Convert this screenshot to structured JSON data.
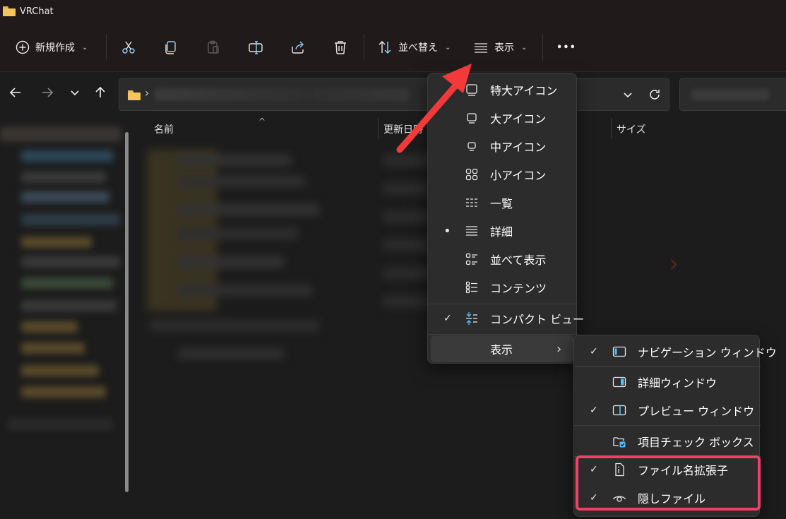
{
  "window": {
    "title": "VRChat"
  },
  "toolbar": {
    "new_label": "新規作成",
    "sort_label": "並べ替え",
    "view_label": "表示",
    "more_label": "•••"
  },
  "file_list": {
    "columns": [
      "名前",
      "更新日時",
      "サイズ"
    ]
  },
  "view_menu": {
    "items": [
      {
        "label": "特大アイコン",
        "icon": "extra-large-icons-icon",
        "mark": ""
      },
      {
        "label": "大アイコン",
        "icon": "large-icons-icon",
        "mark": ""
      },
      {
        "label": "中アイコン",
        "icon": "medium-icons-icon",
        "mark": ""
      },
      {
        "label": "小アイコン",
        "icon": "small-icons-icon",
        "mark": ""
      },
      {
        "label": "一覧",
        "icon": "list-icon",
        "mark": ""
      },
      {
        "label": "詳細",
        "icon": "details-icon",
        "mark": "•"
      },
      {
        "label": "並べて表示",
        "icon": "tiles-icon",
        "mark": ""
      },
      {
        "label": "コンテンツ",
        "icon": "content-icon",
        "mark": ""
      },
      {
        "label": "コンパクト ビュー",
        "icon": "compact-view-icon",
        "mark": "✓"
      },
      {
        "label": "表示",
        "icon": "",
        "mark": "",
        "submenu": true
      }
    ],
    "submenu_chevron": "›"
  },
  "show_submenu": {
    "items": [
      {
        "label": "ナビゲーション ウィンドウ",
        "icon": "navigation-pane-icon",
        "mark": "✓"
      },
      {
        "label": "詳細ウィンドウ",
        "icon": "details-pane-icon",
        "mark": ""
      },
      {
        "label": "プレビュー ウィンドウ",
        "icon": "preview-pane-icon",
        "mark": "✓"
      },
      {
        "label": "項目チェック ボックス",
        "icon": "item-checkbox-icon",
        "mark": ""
      },
      {
        "label": "ファイル名拡張子",
        "icon": "file-extension-icon",
        "mark": "✓"
      },
      {
        "label": "隠しファイル",
        "icon": "hidden-files-icon",
        "mark": "✓"
      }
    ]
  },
  "colors": {
    "highlight": "#f0406a",
    "arrow": "#f23a3a",
    "accent": "#4cc2ff"
  }
}
